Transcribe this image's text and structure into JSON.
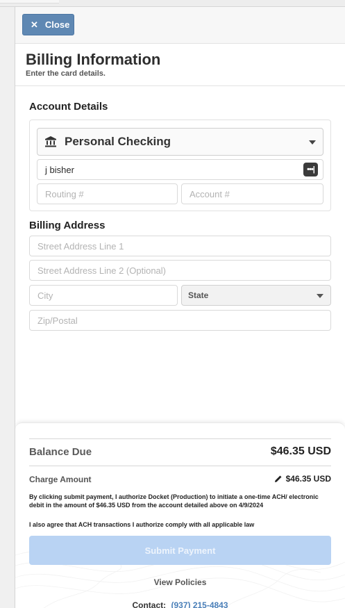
{
  "header": {
    "close_label": "Close"
  },
  "title": {
    "heading": "Billing Information",
    "subtitle": "Enter the card details."
  },
  "account": {
    "section_title": "Account Details",
    "account_type": "Personal Checking",
    "name_value": "j bisher",
    "routing_placeholder": "Routing #",
    "account_placeholder": "Account #"
  },
  "billing": {
    "section_title": "Billing Address",
    "street1_placeholder": "Street Address Line 1",
    "street2_placeholder": "Street Address Line 2 (Optional)",
    "city_placeholder": "City",
    "state_label": "State",
    "zip_placeholder": "Zip/Postal"
  },
  "summary": {
    "balance_label": "Balance Due",
    "balance_value": "$46.35 USD",
    "charge_label": "Charge Amount",
    "charge_value": "$46.35 USD",
    "authorization_text": "By clicking submit payment, I authorize Docket (Production) to initiate a one-time ACH/ electronic debit in the amount of $46.35 USD from the account detailed above on 4/9/2024",
    "agreement_text": "I also agree that ACH transactions I authorize comply with all applicable law",
    "submit_label": "Submit Payment",
    "policies_label": "View Policies",
    "contact_label": "Contact:",
    "contact_phone": "(937) 215-4843"
  },
  "colors": {
    "accent": "#5f88b3",
    "submit_disabled": "#b9d3f3",
    "link": "#4a7fb8"
  }
}
